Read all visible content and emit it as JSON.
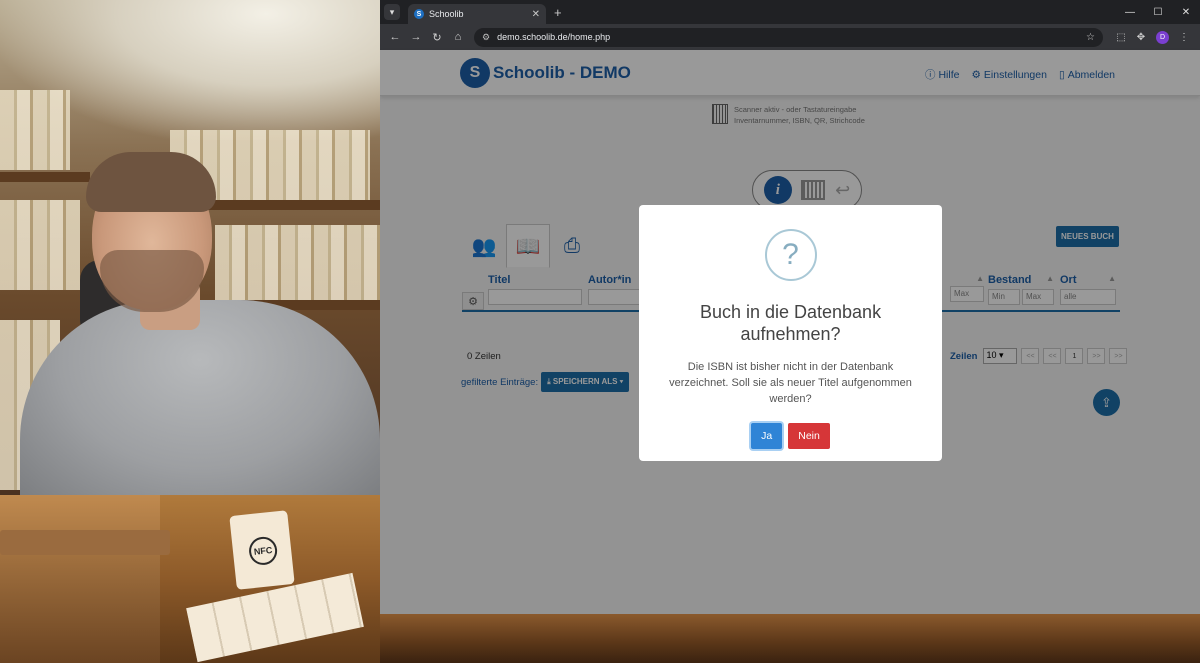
{
  "browser": {
    "tab_title": "Schoolib",
    "url": "demo.schoolib.de/home.php",
    "profile_initial": "D"
  },
  "app": {
    "brand": "Schoolib - DEMO",
    "logo_letter": "S",
    "links": {
      "help": "Hilfe",
      "settings": "Einstellungen",
      "logout": "Abmelden"
    },
    "scanner_hint": {
      "line1": "Scanner aktiv - oder Tastatureingabe",
      "line2": "Inventarnummer, ISBN, QR, Strichcode"
    },
    "new_book_label": "NEUES BUCH",
    "columns": {
      "titel": "Titel",
      "autor": "Autor*in",
      "bestand": "Bestand",
      "ort": "Ort"
    },
    "filters": {
      "max1": "Max",
      "min": "Min",
      "max2": "Max",
      "ort": "alle"
    },
    "rows_count": "0 Zeilen",
    "filtered_label": "gefilterte Einträge:",
    "save_label": "SPEICHERN ALS",
    "pager": {
      "label": "Zeilen",
      "page_size": "10",
      "first": "<<",
      "prev": "<<",
      "current": "1",
      "next": ">>",
      "last": ">>"
    }
  },
  "modal": {
    "icon": "?",
    "title": "Buch in die Datenbank aufnehmen?",
    "text": "Die ISBN ist bisher nicht in der Datenbank verzeichnet. Soll sie als neuer Titel aufgenommen werden?",
    "yes_label": "Ja",
    "no_label": "Nein",
    "colors": {
      "yes": "#2f84d6",
      "no": "#d63638"
    }
  },
  "desk": {
    "nfc_label": "NFC"
  }
}
